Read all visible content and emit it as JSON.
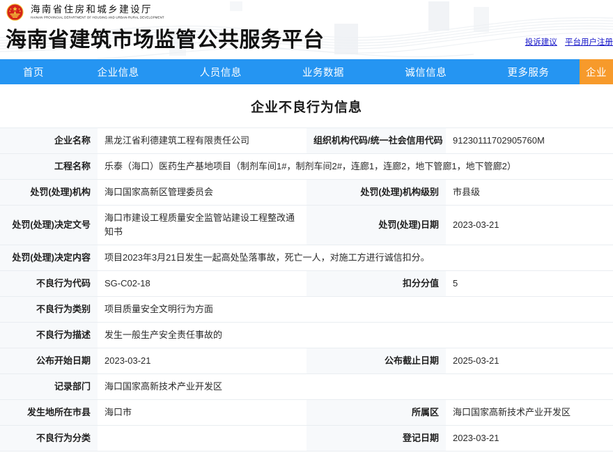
{
  "header": {
    "emblem_icon": "national-emblem-icon",
    "department_cn": "海南省住房和城乡建设厅",
    "department_en": "HAINAN PROVINCIAL DEPARTMENT OF HOUSING AND URBAN-RURAL DEVELOPMENT",
    "platform_title": "海南省建筑市场监管公共服务平台",
    "links": [
      {
        "label": "投诉建议"
      },
      {
        "label": "平台用户注册"
      }
    ]
  },
  "nav": {
    "background_color": "#2595f2",
    "cta_color": "#f79a2b",
    "items": [
      {
        "label": "首页"
      },
      {
        "label": "企业信息"
      },
      {
        "label": "人员信息"
      },
      {
        "label": "业务数据"
      },
      {
        "label": "诚信信息"
      },
      {
        "label": "更多服务"
      }
    ],
    "cta_label": "企业"
  },
  "main": {
    "page_title": "企业不良行为信息",
    "rows": [
      {
        "label1": "企业名称",
        "value1": "黑龙江省利德建筑工程有限责任公司",
        "label2": "组织机构代码/统一社会信用代码",
        "value2": "91230111702905760M"
      },
      {
        "label1": "工程名称",
        "value1": "乐泰（海口）医药生产基地项目（制剂车间1#，制剂车间2#，连廊1，连廊2，地下管廊1，地下管廊2）",
        "span": true
      },
      {
        "label1": "处罚(处理)机构",
        "value1": "海口国家高新区管理委员会",
        "label2": "处罚(处理)机构级别",
        "value2": "市县级"
      },
      {
        "label1": "处罚(处理)决定文号",
        "value1": "海口市建设工程质量安全监管站建设工程整改通知书",
        "label2": "处罚(处理)日期",
        "value2": "2023-03-21",
        "tall": true
      },
      {
        "label1": "处罚(处理)决定内容",
        "value1": "项目2023年3月21日发生一起高处坠落事故，死亡一人，对施工方进行诚信扣分。",
        "span": true
      },
      {
        "label1": "不良行为代码",
        "value1": "SG-C02-18",
        "label2": "扣分分值",
        "value2": "5"
      },
      {
        "label1": "不良行为类别",
        "value1": "项目质量安全文明行为方面",
        "span": true
      },
      {
        "label1": "不良行为描述",
        "value1": "发生一般生产安全责任事故的",
        "span": true
      },
      {
        "label1": "公布开始日期",
        "value1": "2023-03-21",
        "label2": "公布截止日期",
        "value2": "2025-03-21"
      },
      {
        "label1": "记录部门",
        "value1": "海口国家高新技术产业开发区",
        "span": true
      },
      {
        "label1": "发生地所在市县",
        "value1": "海口市",
        "label2": "所属区",
        "value2": "海口国家高新技术产业开发区"
      },
      {
        "label1": "不良行为分类",
        "value1": "",
        "label2": "登记日期",
        "value2": "2023-03-21"
      }
    ]
  }
}
